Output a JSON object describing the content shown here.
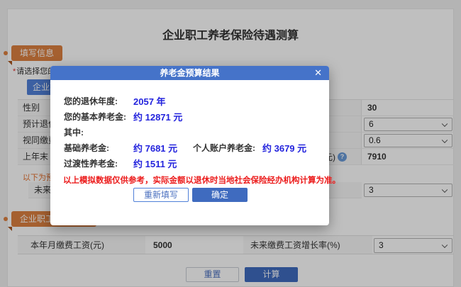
{
  "colors": {
    "accent_blue": "#4573c9",
    "value_blue": "#2323dd",
    "warning_red": "#ec1c1c",
    "badge_orange": "#dd8140",
    "tab_blue": "#5080d8"
  },
  "page": {
    "title": "企业职工养老保险待遇测算",
    "fill_info_badge": "填写信息",
    "required_star": "*",
    "select_prompt": "请选择您的",
    "tab_label": "企业职工",
    "help_icon": "?",
    "table1": {
      "rows": [
        {
          "label": "性别",
          "value": "30"
        },
        {
          "label": "预计退休",
          "value": "6"
        },
        {
          "label": "视同缴费",
          "value": "0.6"
        },
        {
          "label": "上年末",
          "label_right_tail": "资(元)",
          "value": "7910"
        }
      ]
    },
    "forecast_note": "以下为预测",
    "future_row": {
      "label": "未来在",
      "value": "3"
    },
    "section2_badge": "企业职工缴费信息",
    "table2": {
      "label1": "本年月缴费工资(元)",
      "value1": "5000",
      "label2": "未来缴费工资增长率(%)",
      "value2": "3"
    },
    "reset_button": "重置",
    "calculate_button": "计算"
  },
  "modal": {
    "title": "养老金预算结果",
    "close_icon": "✕",
    "retirement_year_label": "您的退休年度:",
    "retirement_year_value": "2057 年",
    "basic_pension_label": "您的基本养老金:",
    "basic_pension_value": "约 12871 元",
    "among_label": "其中:",
    "base_pension_label": "基础养老金:",
    "base_pension_value": "约 7681 元",
    "personal_account_label": "个人账户养老金:",
    "personal_account_value": "约 3679 元",
    "transitional_label": "过渡性养老金:",
    "transitional_value": "约 1511 元",
    "disclaimer": "以上模拟数据仅供参考，实际金额以退休时当地社会保险经办机构计算为准。",
    "refill_button": "重新填写",
    "confirm_button": "确定"
  }
}
